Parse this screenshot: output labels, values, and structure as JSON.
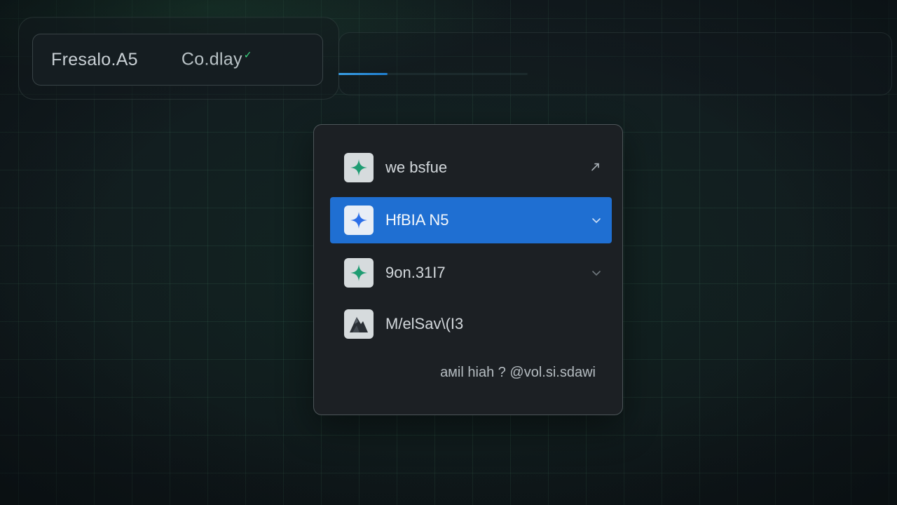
{
  "topbar": {
    "tabs": [
      {
        "label": "Fresalo.A5"
      },
      {
        "label": "Co.dlay"
      }
    ]
  },
  "progress": {
    "value": 0.26
  },
  "dropdown": {
    "items": [
      {
        "label": "we bsfue",
        "icon": "sparkle-icon",
        "state": "normal",
        "trailing": "arrow-icon"
      },
      {
        "label": "HfBIA N5",
        "icon": "sparkle-icon",
        "state": "selected",
        "trailing": "chevron-down-icon"
      },
      {
        "label": "9on.31I7",
        "icon": "sparkle-icon",
        "state": "normal",
        "trailing": "chevron-down-icon"
      },
      {
        "label": "M/elSav\\(I3",
        "icon": "mountain-icon",
        "state": "normal",
        "trailing": ""
      }
    ],
    "footer": "aмil hiah ? @vol.si.sdawi"
  },
  "colors": {
    "accent": "#1f6fd2",
    "sparkle_green": "#1e9c72",
    "sparkle_blue": "#2b6fe8",
    "check_green": "#3ddc84"
  }
}
